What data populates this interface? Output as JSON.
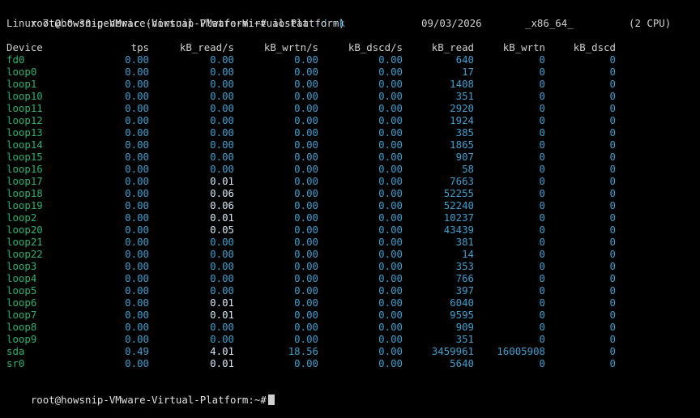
{
  "prompt": {
    "user_host": "root@howsnip-VMware-Virtual-Platform:~#",
    "command": "iostat",
    "flags": "-d -k",
    "final_prompt": "root@howsnip-VMware-Virtual-Platform:~#"
  },
  "sysinfo": {
    "kernel": "Linux 7.0.0-30-generic (howsnip-VMware-Virtual-Platform)",
    "date": "09/03/2026",
    "arch": "_x86_64_",
    "cpus": "(2 CPU)"
  },
  "table": {
    "headers": [
      "Device",
      "tps",
      "kB_read/s",
      "kB_wrtn/s",
      "kB_dscd/s",
      "kB_read",
      "kB_wrtn",
      "kB_dscd"
    ],
    "rows": [
      [
        "fd0",
        "0.00",
        "0.00",
        "0.00",
        "0.00",
        "640",
        "0",
        "0"
      ],
      [
        "loop0",
        "0.00",
        "0.00",
        "0.00",
        "0.00",
        "17",
        "0",
        "0"
      ],
      [
        "loop1",
        "0.00",
        "0.00",
        "0.00",
        "0.00",
        "1408",
        "0",
        "0"
      ],
      [
        "loop10",
        "0.00",
        "0.00",
        "0.00",
        "0.00",
        "351",
        "0",
        "0"
      ],
      [
        "loop11",
        "0.00",
        "0.00",
        "0.00",
        "0.00",
        "2920",
        "0",
        "0"
      ],
      [
        "loop12",
        "0.00",
        "0.00",
        "0.00",
        "0.00",
        "1924",
        "0",
        "0"
      ],
      [
        "loop13",
        "0.00",
        "0.00",
        "0.00",
        "0.00",
        "385",
        "0",
        "0"
      ],
      [
        "loop14",
        "0.00",
        "0.00",
        "0.00",
        "0.00",
        "1865",
        "0",
        "0"
      ],
      [
        "loop15",
        "0.00",
        "0.00",
        "0.00",
        "0.00",
        "907",
        "0",
        "0"
      ],
      [
        "loop16",
        "0.00",
        "0.00",
        "0.00",
        "0.00",
        "58",
        "0",
        "0"
      ],
      [
        "loop17",
        "0.00",
        "0.01",
        "0.00",
        "0.00",
        "7663",
        "0",
        "0"
      ],
      [
        "loop18",
        "0.00",
        "0.06",
        "0.00",
        "0.00",
        "52255",
        "0",
        "0"
      ],
      [
        "loop19",
        "0.00",
        "0.06",
        "0.00",
        "0.00",
        "52240",
        "0",
        "0"
      ],
      [
        "loop2",
        "0.00",
        "0.01",
        "0.00",
        "0.00",
        "10237",
        "0",
        "0"
      ],
      [
        "loop20",
        "0.00",
        "0.05",
        "0.00",
        "0.00",
        "43439",
        "0",
        "0"
      ],
      [
        "loop21",
        "0.00",
        "0.00",
        "0.00",
        "0.00",
        "381",
        "0",
        "0"
      ],
      [
        "loop22",
        "0.00",
        "0.00",
        "0.00",
        "0.00",
        "14",
        "0",
        "0"
      ],
      [
        "loop3",
        "0.00",
        "0.00",
        "0.00",
        "0.00",
        "353",
        "0",
        "0"
      ],
      [
        "loop4",
        "0.00",
        "0.00",
        "0.00",
        "0.00",
        "766",
        "0",
        "0"
      ],
      [
        "loop5",
        "0.00",
        "0.00",
        "0.00",
        "0.00",
        "397",
        "0",
        "0"
      ],
      [
        "loop6",
        "0.00",
        "0.01",
        "0.00",
        "0.00",
        "6040",
        "0",
        "0"
      ],
      [
        "loop7",
        "0.00",
        "0.01",
        "0.00",
        "0.00",
        "9595",
        "0",
        "0"
      ],
      [
        "loop8",
        "0.00",
        "0.00",
        "0.00",
        "0.00",
        "909",
        "0",
        "0"
      ],
      [
        "loop9",
        "0.00",
        "0.00",
        "0.00",
        "0.00",
        "351",
        "0",
        "0"
      ],
      [
        "sda",
        "0.49",
        "4.01",
        "18.56",
        "0.00",
        "3459961",
        "16005908",
        "0"
      ],
      [
        "sr0",
        "0.00",
        "0.01",
        "0.00",
        "0.00",
        "5640",
        "0",
        "0"
      ]
    ]
  },
  "colors": {
    "background": "#000000",
    "text": "#d0d0d0",
    "device": "#27b36f",
    "value_zero": "#3aa0d0",
    "value_nonzero": "#d0e8f5"
  }
}
